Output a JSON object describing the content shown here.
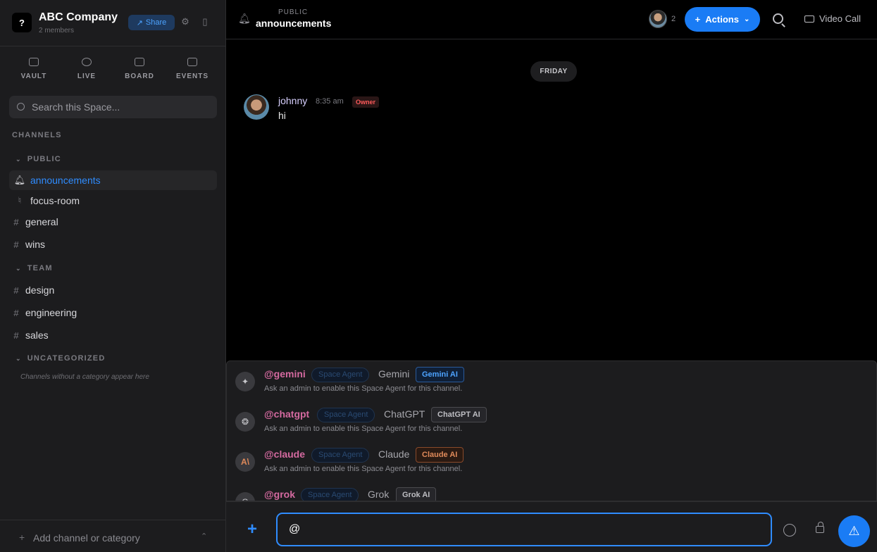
{
  "workspace": {
    "name": "ABC Company",
    "members": "2 members",
    "share_label": "Share"
  },
  "quick_nav": [
    {
      "label": "VAULT",
      "icon": "vault-icon"
    },
    {
      "label": "LIVE",
      "icon": "live-icon"
    },
    {
      "label": "BOARD",
      "icon": "board-icon"
    },
    {
      "label": "EVENTS",
      "icon": "calendar-icon"
    }
  ],
  "search": {
    "placeholder": "Search this Space..."
  },
  "sidebar": {
    "channels_heading": "CHANNELS",
    "categories": [
      {
        "label": "PUBLIC"
      },
      {
        "label": "TEAM"
      },
      {
        "label": "UNCATEGORIZED"
      }
    ],
    "channels": [
      {
        "label": "announcements",
        "icon": "bell-icon",
        "active": true
      },
      {
        "label": "focus-room",
        "icon": "microphone-icon"
      },
      {
        "label": "general",
        "icon": "hash-icon"
      },
      {
        "label": "wins",
        "icon": "hash-icon"
      },
      {
        "label": "design",
        "icon": "hash-icon"
      },
      {
        "label": "engineering",
        "icon": "hash-icon"
      },
      {
        "label": "sales",
        "icon": "hash-icon"
      }
    ],
    "uncategorized_note": "Channels without a category appear here",
    "add_label": "Add channel or category"
  },
  "header": {
    "kicker": "PUBLIC",
    "channel": "announcements",
    "member_count": "2",
    "actions_label": "Actions",
    "video_call_label": "Video Call"
  },
  "messages": {
    "day": "FRIDAY",
    "items": [
      {
        "author": "johnny",
        "time": "8:35 am",
        "badge": "Owner",
        "text": "hi"
      }
    ]
  },
  "mentions": [
    {
      "handle": "@gemini",
      "tag": "Space Agent",
      "name": "Gemini",
      "ai": "Gemini AI",
      "ai_color": "#4da3ff",
      "note": "Ask an admin to enable this Space Agent for this channel.",
      "icon_glyph": "✦"
    },
    {
      "handle": "@chatgpt",
      "tag": "Space Agent",
      "name": "ChatGPT",
      "ai": "ChatGPT AI",
      "ai_color": "#bdbdc2",
      "note": "Ask an admin to enable this Space Agent for this channel.",
      "icon_glyph": "❂"
    },
    {
      "handle": "@claude",
      "tag": "Space Agent",
      "name": "Claude",
      "ai": "Claude AI",
      "ai_color": "#e08a5a",
      "note": "Ask an admin to enable this Space Agent for this channel.",
      "icon_glyph": "A\\"
    },
    {
      "handle": "@grok",
      "tag": "Space Agent",
      "name": "Grok",
      "ai": "Grok AI",
      "ai_color": "#bdbdc2",
      "note": "",
      "icon_glyph": "G"
    }
  ],
  "composer": {
    "value": "@"
  }
}
